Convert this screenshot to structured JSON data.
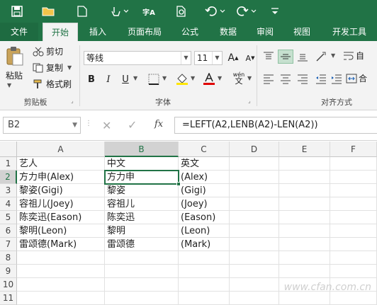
{
  "qat": {
    "items": [
      "save-icon",
      "open-icon",
      "new-icon",
      "touch-mode-icon",
      "spell-check-icon",
      "print-preview-icon",
      "undo-icon",
      "redo-icon",
      "customize-icon"
    ],
    "spell_glyph": "字A"
  },
  "tabs": [
    "文件",
    "开始",
    "插入",
    "页面布局",
    "公式",
    "数据",
    "审阅",
    "视图",
    "开发工具"
  ],
  "ribbon": {
    "clipboard": {
      "paste": "粘贴",
      "cut": "剪切",
      "copy": "复制",
      "format_painter": "格式刷",
      "label": "剪贴板"
    },
    "font": {
      "name": "等线",
      "size": "11",
      "bold": "B",
      "italic": "I",
      "underline": "U",
      "grow": "A",
      "shrink": "A",
      "phonetic": "wén",
      "label": "字体"
    },
    "align": {
      "label": "对齐方式",
      "wrap_partial": "自",
      "merge_partial": "合"
    }
  },
  "formula_bar": {
    "name_box": "B2",
    "fx": "fx",
    "formula": "=LEFT(A2,LENB(A2)-LEN(A2))"
  },
  "sheet": {
    "columns": [
      "A",
      "B",
      "C",
      "D",
      "E",
      "F"
    ],
    "selected_cell": "B2",
    "rows": [
      {
        "n": "1",
        "a": "艺人",
        "b": "中文",
        "c": "英文"
      },
      {
        "n": "2",
        "a": "方力申(Alex)",
        "b": "方力申",
        "c": "(Alex)"
      },
      {
        "n": "3",
        "a": "黎姿(Gigi)",
        "b": "黎姿",
        "c": "(Gigi)"
      },
      {
        "n": "4",
        "a": "容祖儿(Joey)",
        "b": "容祖儿",
        "c": "(Joey)"
      },
      {
        "n": "5",
        "a": "陈奕迅(Eason)",
        "b": "陈奕迅",
        "c": "(Eason)"
      },
      {
        "n": "6",
        "a": "黎明(Leon)",
        "b": "黎明",
        "c": "(Leon)"
      },
      {
        "n": "7",
        "a": "雷颂德(Mark)",
        "b": "雷颂德",
        "c": "(Mark)"
      },
      {
        "n": "8",
        "a": "",
        "b": "",
        "c": ""
      },
      {
        "n": "9",
        "a": "",
        "b": "",
        "c": ""
      },
      {
        "n": "10",
        "a": "",
        "b": "",
        "c": ""
      },
      {
        "n": "11",
        "a": "",
        "b": "",
        "c": ""
      }
    ]
  },
  "watermark": "www.cfan.com.cn",
  "colors": {
    "accent": "#217346"
  }
}
